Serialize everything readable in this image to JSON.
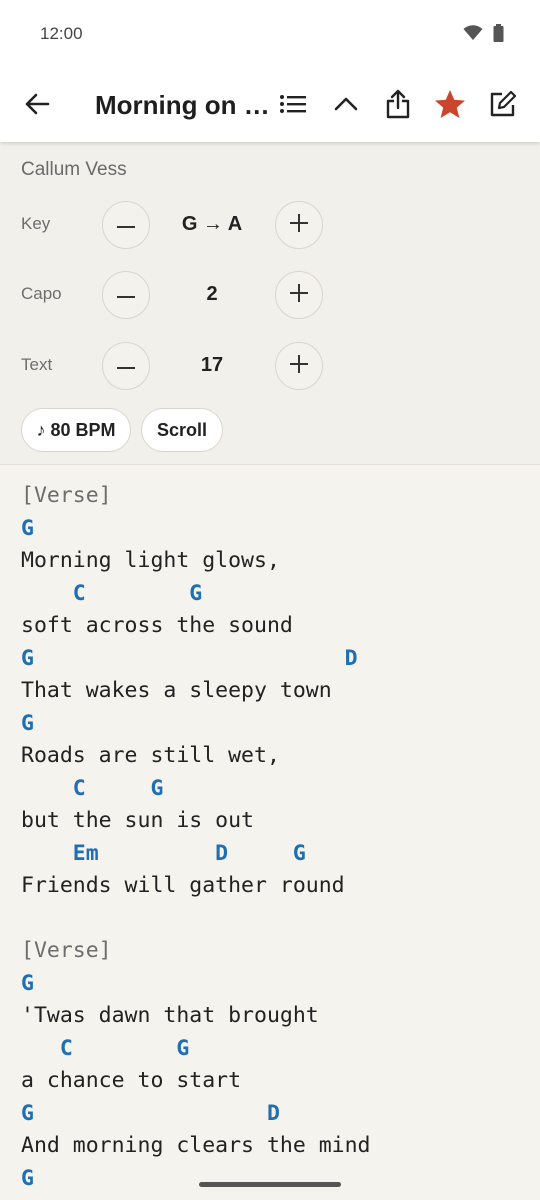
{
  "status_bar": {
    "time": "12:00",
    "icons": [
      "wifi-icon",
      "battery-icon"
    ]
  },
  "app_bar": {
    "title": "Morning on t...",
    "icons": [
      "back-arrow-icon",
      "list-icon",
      "chevron-up-icon",
      "share-icon",
      "star-icon",
      "edit-icon"
    ],
    "favorite_color": "#c9452c"
  },
  "controls": {
    "artist": "Callum Vess",
    "key": {
      "label": "Key",
      "value": "G → A"
    },
    "capo": {
      "label": "Capo",
      "value": "2"
    },
    "text_size": {
      "label": "Text",
      "value": "17"
    },
    "bpm_label": "♪ 80 BPM",
    "scroll_label": "Scroll"
  },
  "sheet": {
    "chord_color": "#1f6fb2",
    "lines": [
      {
        "type": "section",
        "text": "[Verse]"
      },
      {
        "type": "chord",
        "text": "G"
      },
      {
        "type": "lyric",
        "text": "Morning light glows,"
      },
      {
        "type": "chord",
        "text": "    C        G"
      },
      {
        "type": "lyric",
        "text": "soft across the sound"
      },
      {
        "type": "chord",
        "text": "G                        D"
      },
      {
        "type": "lyric",
        "text": "That wakes a sleepy town"
      },
      {
        "type": "chord",
        "text": "G"
      },
      {
        "type": "lyric",
        "text": "Roads are still wet,"
      },
      {
        "type": "chord",
        "text": "    C     G"
      },
      {
        "type": "lyric",
        "text": "but the sun is out"
      },
      {
        "type": "chord",
        "text": "    Em         D     G"
      },
      {
        "type": "lyric",
        "text": "Friends will gather round"
      },
      {
        "type": "blank",
        "text": " "
      },
      {
        "type": "section",
        "text": "[Verse]"
      },
      {
        "type": "chord",
        "text": "G"
      },
      {
        "type": "lyric",
        "text": "'Twas dawn that brought"
      },
      {
        "type": "chord",
        "text": "   C        G"
      },
      {
        "type": "lyric",
        "text": "a chance to start"
      },
      {
        "type": "chord",
        "text": "G                  D"
      },
      {
        "type": "lyric",
        "text": "And morning clears the mind"
      },
      {
        "type": "chord",
        "text": "G"
      }
    ]
  }
}
